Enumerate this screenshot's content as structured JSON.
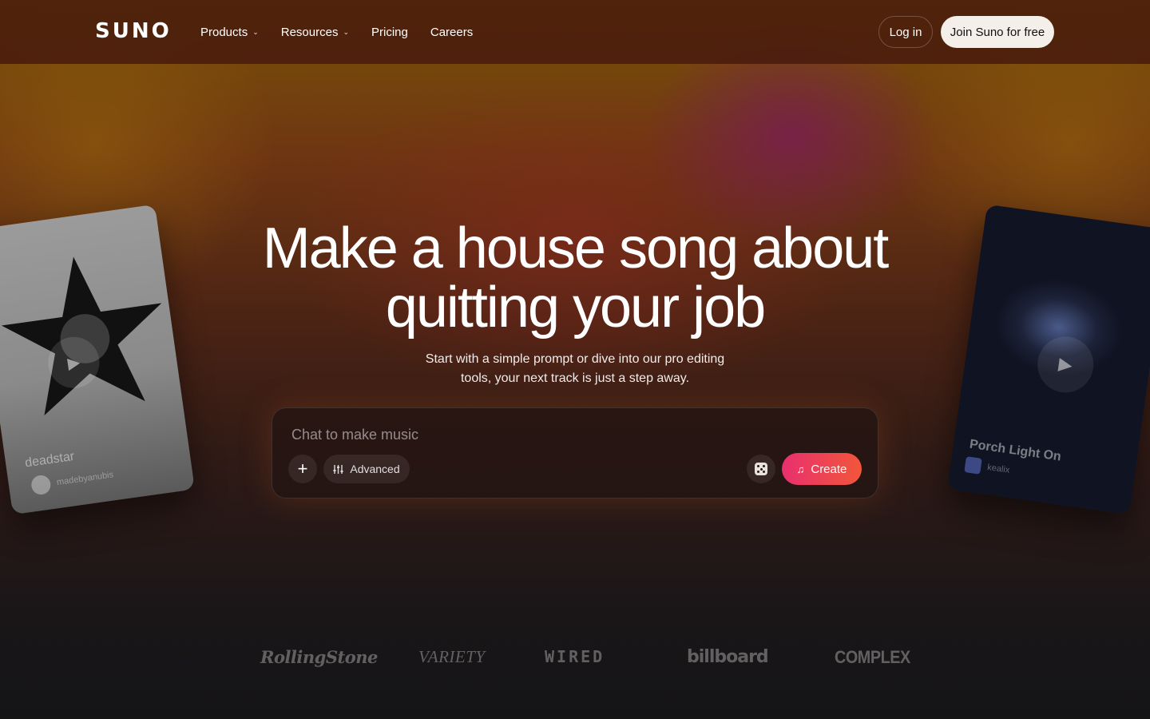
{
  "header": {
    "logo": "SUNO",
    "nav": [
      {
        "label": "Products",
        "has_dropdown": true
      },
      {
        "label": "Resources",
        "has_dropdown": true
      },
      {
        "label": "Pricing",
        "has_dropdown": false
      },
      {
        "label": "Careers",
        "has_dropdown": false
      }
    ],
    "login_label": "Log in",
    "join_label": "Join Suno for free"
  },
  "hero": {
    "title_line1": "Make a house song about",
    "title_line2": "quitting your job",
    "subtitle_line1": "Start with a simple prompt or dive into our pro editing",
    "subtitle_line2": "tools, your next track is just a step away."
  },
  "prompt": {
    "placeholder": "Chat to make music",
    "value": "",
    "add_icon": "plus-icon",
    "advanced_label": "Advanced",
    "advanced_icon": "sliders-icon",
    "random_icon": "dice-icon",
    "create_label": "Create",
    "create_icon": "music-note-icon"
  },
  "cards": {
    "left": {
      "title": "deadstar",
      "artist": "madebyanubis"
    },
    "right": {
      "title": "Porch Light On",
      "artist": "kealix"
    }
  },
  "press": [
    "RollingStone",
    "VARIETY",
    "WIRED",
    "billboard",
    "COMPLEX"
  ],
  "colors": {
    "create_gradient_start": "#e8306e",
    "create_gradient_end": "#f2563a",
    "join_bg": "#f4efe8"
  }
}
